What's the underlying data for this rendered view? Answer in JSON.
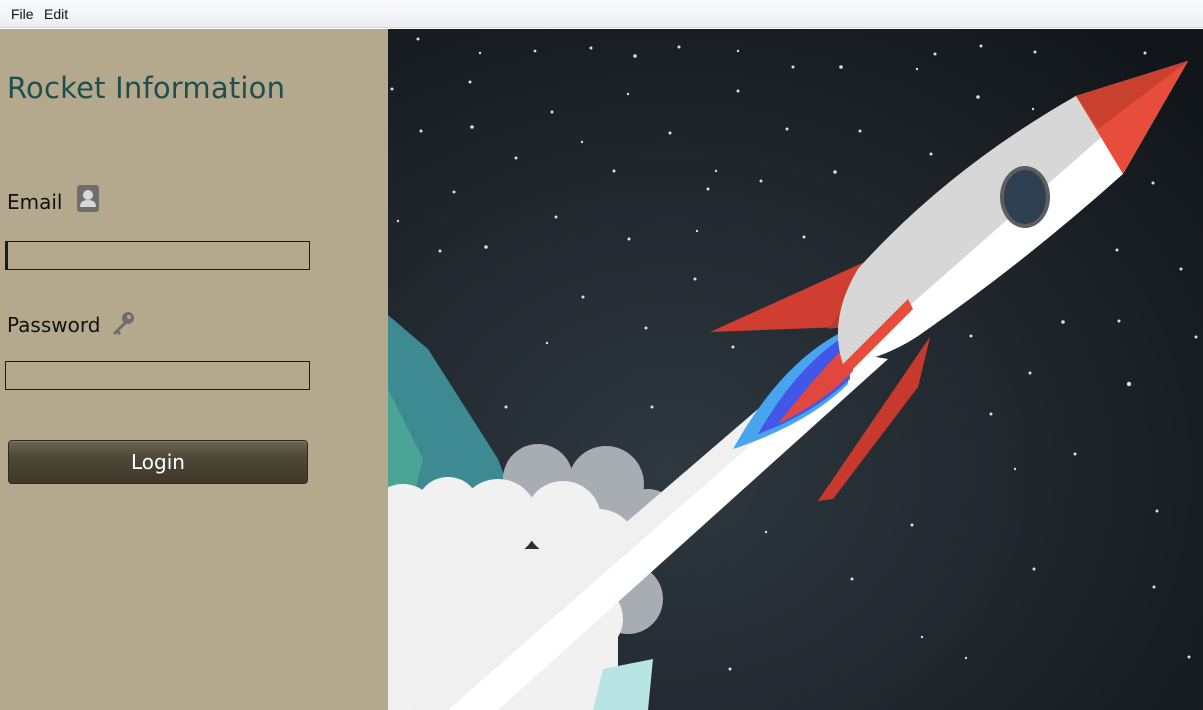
{
  "menu": {
    "file": "File",
    "edit": "Edit"
  },
  "login": {
    "title": "Rocket Information",
    "email_label": "Email",
    "email_value": "",
    "password_label": "Password",
    "password_value": "",
    "button_label": "Login"
  },
  "icons": {
    "email": "contact-card-icon",
    "password": "key-icon"
  },
  "colors": {
    "panel_bg": "#b5a98d",
    "title": "#1f4e4f",
    "button": "#4d4837",
    "space": "#1f262e",
    "rocket_red": "#e84d3c",
    "flame_blue": "#3b6ff0"
  }
}
